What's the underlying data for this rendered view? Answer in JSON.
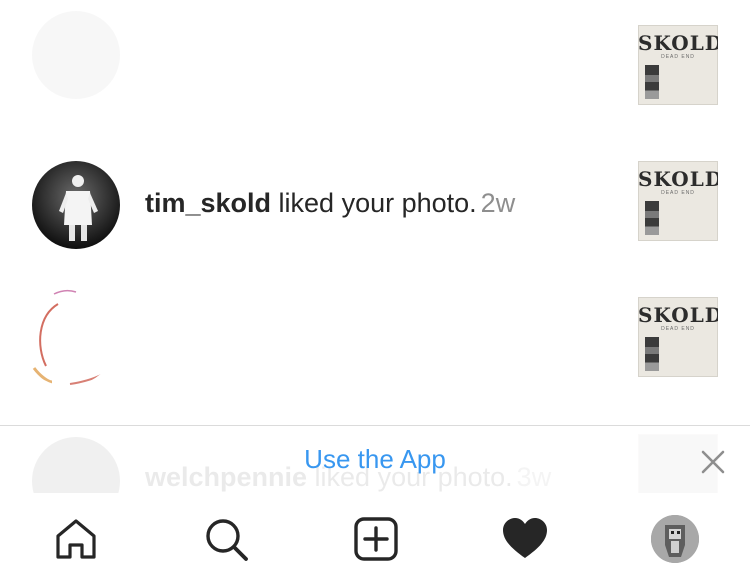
{
  "notifications": [
    {
      "username": "",
      "action": "",
      "time": "",
      "thumb_title": "SKOLD",
      "thumb_subtitle": "DEAD END",
      "faded": true
    },
    {
      "username": "tim_skold",
      "action": " liked your photo.",
      "time": "2w",
      "thumb_title": "SKOLD",
      "thumb_subtitle": "DEAD END",
      "faded": false
    },
    {
      "username": "",
      "action": "",
      "time": "",
      "thumb_title": "SKOLD",
      "thumb_subtitle": "DEAD END",
      "faded": true
    },
    {
      "username": "welchpennie",
      "action": " liked your photo.",
      "time": "3w",
      "thumb_title": "",
      "thumb_subtitle": "",
      "faded": true
    }
  ],
  "banner": {
    "label": "Use the App",
    "close_icon": "close-icon",
    "accent_color": "#3897f0"
  },
  "tabbar": {
    "items": [
      {
        "icon": "home-icon"
      },
      {
        "icon": "search-icon"
      },
      {
        "icon": "new-post-icon"
      },
      {
        "icon": "heart-icon",
        "active": true
      },
      {
        "icon": "profile-avatar"
      }
    ]
  },
  "colors": {
    "text": "#262626",
    "secondary_text": "#8e8e8e",
    "divider": "#dbdbdb"
  }
}
